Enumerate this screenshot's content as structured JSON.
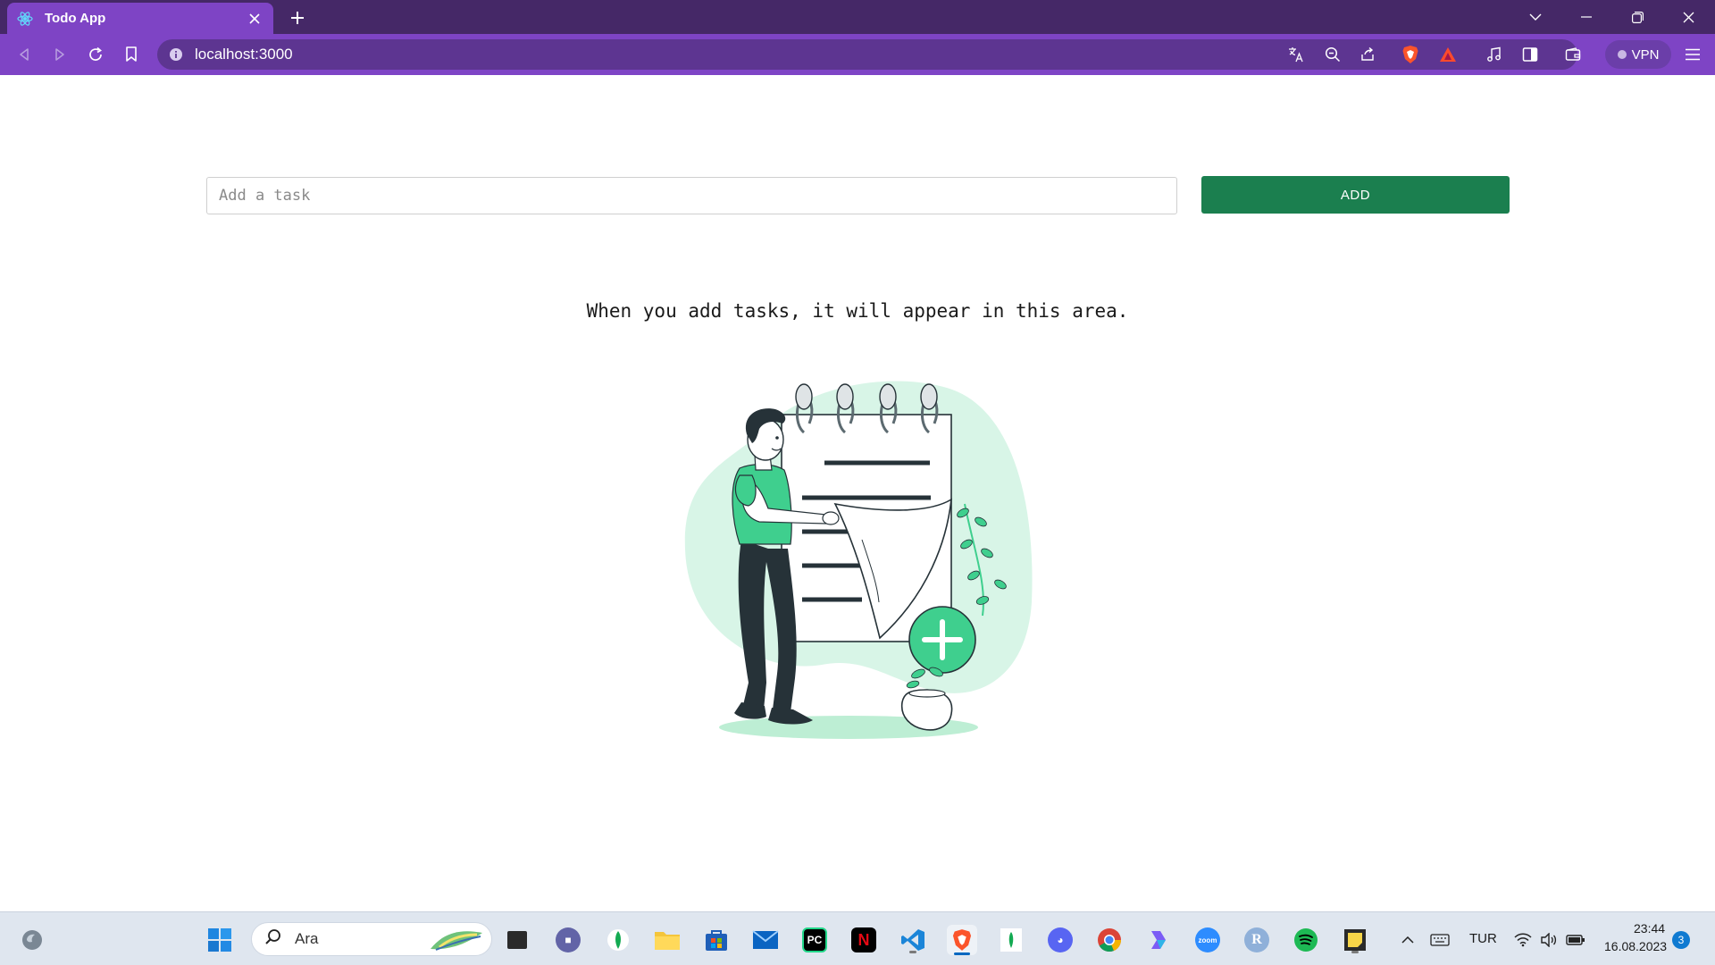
{
  "browser": {
    "tab": {
      "title": "Todo App",
      "favicon": "react-icon"
    },
    "address": {
      "url": "localhost:3000"
    },
    "vpn_label": "VPN"
  },
  "app": {
    "input_placeholder": "Add a task",
    "input_value": "",
    "add_label": "ADD",
    "empty_message": "When you add tasks, it will appear in this area."
  },
  "taskbar": {
    "search_placeholder": "Ara",
    "language": "TUR",
    "time": "23:44",
    "date": "16.08.2023",
    "notification_count": "3",
    "apps": [
      "start",
      "file-explorer-icon",
      "teams-icon",
      "mongodb-icon",
      "folder-icon",
      "store-icon",
      "mail-icon",
      "pycharm-icon",
      "netflix-icon",
      "vscode-icon",
      "brave-icon",
      "mongodb-compass-icon",
      "discord-icon",
      "chrome-icon",
      "copilot-icon",
      "zoom-icon",
      "r-icon",
      "spotify-icon",
      "sticky-notes-icon"
    ]
  },
  "colors": {
    "tab_strip": "#452867",
    "toolbar": "#7e44c5",
    "add_button": "#1b7f4f",
    "illustration_accent": "#3fcf8e"
  }
}
